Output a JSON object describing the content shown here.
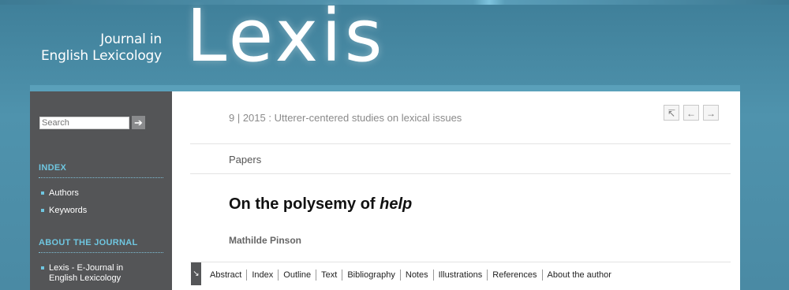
{
  "header": {
    "journal_line1": "Journal in",
    "journal_line2": "English Lexicology",
    "logo": "Lexis"
  },
  "sidebar": {
    "search": {
      "placeholder": "Search",
      "button_icon": "arrow-right-icon"
    },
    "index_heading": "INDEX",
    "index_items": [
      "Authors",
      "Keywords"
    ],
    "about_heading": "ABOUT THE JOURNAL",
    "about_items": [
      "Lexis - E-Journal in",
      "English Lexicology"
    ]
  },
  "main": {
    "issue": "9 | 2015 : Utterer-centered studies on lexical issues",
    "nav": {
      "up": "↸",
      "prev": "←",
      "next": "→"
    },
    "section": "Papers",
    "title_prefix": "On the polysemy of ",
    "title_italic": "help",
    "author": "Mathilde Pinson",
    "toc_arrow": "↘",
    "toc_items": [
      "Abstract",
      "Index",
      "Outline",
      "Text",
      "Bibliography",
      "Notes",
      "Illustrations",
      "References",
      "About the author"
    ]
  },
  "colors": {
    "accent": "#6fc6e0",
    "sidebar_bg": "#545557",
    "header_bg": "#4f93ad"
  }
}
